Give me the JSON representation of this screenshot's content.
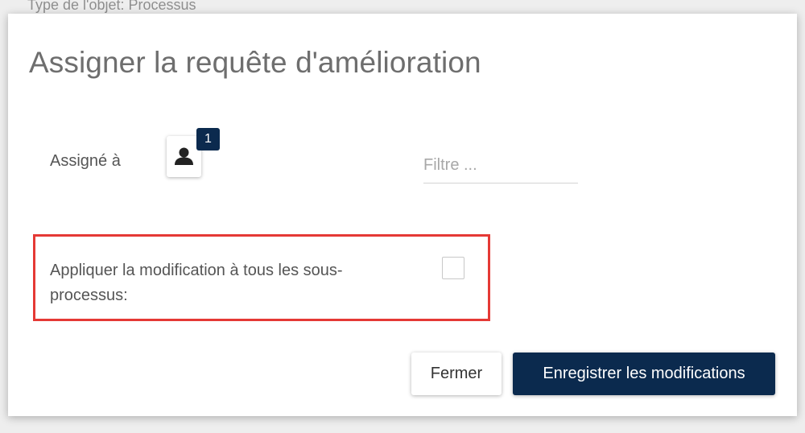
{
  "background": {
    "object_type_text": "Type de l'objet: Processus"
  },
  "dialog": {
    "title": "Assigner la requête d'amélioration",
    "assigned_label": "Assigné à",
    "assignee_count": "1",
    "user_icon": "person-icon",
    "filter": {
      "placeholder": "Filtre ...",
      "value": ""
    },
    "apply_subprocess_label": "Appliquer la modification à tous les sous-processus:",
    "apply_subprocess_checked": false,
    "buttons": {
      "close_label": "Fermer",
      "save_label": "Enregistrer les modifications"
    }
  },
  "colors": {
    "primary": "#0b2a4e",
    "highlight": "#e53935",
    "title": "#6e6e6e",
    "label": "#555555"
  }
}
